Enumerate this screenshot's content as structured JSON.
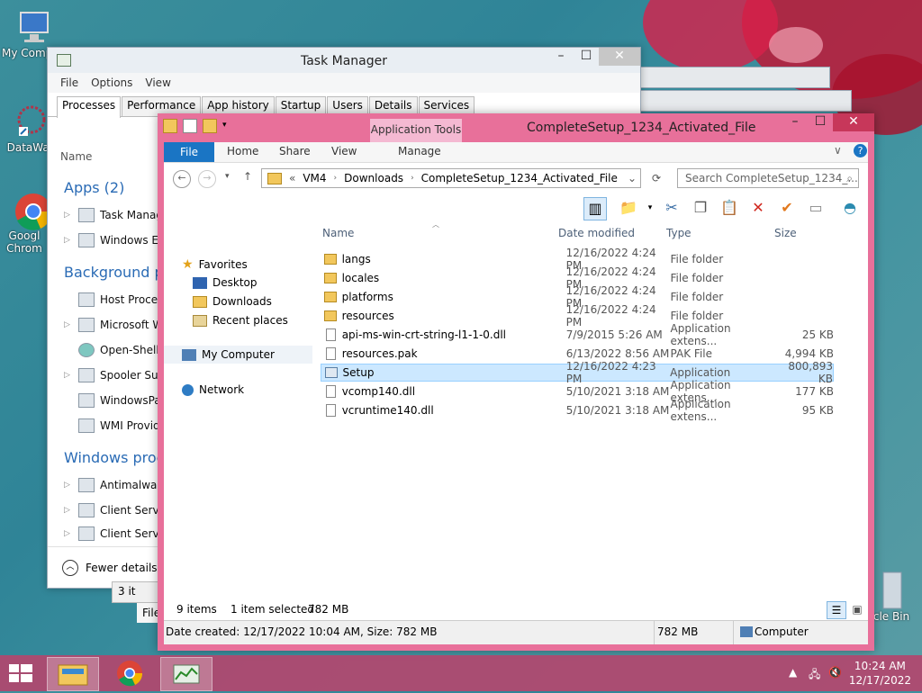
{
  "desktop": {
    "icons": [
      {
        "label": "My Comp"
      },
      {
        "label": "DataWag"
      },
      {
        "label": "Googl Chrom"
      },
      {
        "label": "cle Bin"
      }
    ]
  },
  "task_manager": {
    "title": "Task Manager",
    "menu": [
      "File",
      "Options",
      "View"
    ],
    "tabs": [
      "Processes",
      "Performance",
      "App history",
      "Startup",
      "Users",
      "Details",
      "Services"
    ],
    "column_name": "Name",
    "sections": {
      "apps": "Apps (2)",
      "background": "Background pr",
      "windows": "Windows proce"
    },
    "apps": [
      "Task Manag",
      "Windows Ex"
    ],
    "background": [
      "Host Proces",
      "Microsoft W",
      "Open-Shell",
      "Spooler Sub",
      "WindowsPa",
      "WMI Provid"
    ],
    "windows": [
      "Antimalwar",
      "Client Serve",
      "Client Serve"
    ],
    "fewer_details": "Fewer details",
    "partial_status": "3 it",
    "partial_file": "File"
  },
  "explorer": {
    "title": "CompleteSetup_1234_Activated_File",
    "app_tools": "Application Tools",
    "ribbon_tabs": {
      "file": "File",
      "home": "Home",
      "share": "Share",
      "view": "View",
      "manage": "Manage"
    },
    "address": {
      "prefix": "«",
      "crumbs": [
        "VM4",
        "Downloads",
        "CompleteSetup_1234_Activated_File"
      ]
    },
    "search_placeholder": "Search CompleteSetup_1234_...",
    "nav": {
      "favorites": "Favorites",
      "desktop": "Desktop",
      "downloads": "Downloads",
      "recent": "Recent places",
      "computer": "My Computer",
      "network": "Network"
    },
    "columns": {
      "name": "Name",
      "date": "Date modified",
      "type": "Type",
      "size": "Size"
    },
    "files": [
      {
        "name": "langs",
        "date": "12/16/2022 4:24 PM",
        "type": "File folder",
        "size": ""
      },
      {
        "name": "locales",
        "date": "12/16/2022 4:24 PM",
        "type": "File folder",
        "size": ""
      },
      {
        "name": "platforms",
        "date": "12/16/2022 4:24 PM",
        "type": "File folder",
        "size": ""
      },
      {
        "name": "resources",
        "date": "12/16/2022 4:24 PM",
        "type": "File folder",
        "size": ""
      },
      {
        "name": "api-ms-win-crt-string-l1-1-0.dll",
        "date": "7/9/2015 5:26 AM",
        "type": "Application extens...",
        "size": "25 KB"
      },
      {
        "name": "resources.pak",
        "date": "6/13/2022 8:56 AM",
        "type": "PAK File",
        "size": "4,994 KB"
      },
      {
        "name": "Setup",
        "date": "12/16/2022 4:23 PM",
        "type": "Application",
        "size": "800,893 KB"
      },
      {
        "name": "vcomp140.dll",
        "date": "5/10/2021 3:18 AM",
        "type": "Application extens...",
        "size": "177 KB"
      },
      {
        "name": "vcruntime140.dll",
        "date": "5/10/2021 3:18 AM",
        "type": "Application extens...",
        "size": "95 KB"
      }
    ],
    "status": {
      "items": "9 items",
      "selected": "1 item selected",
      "selected_size": "782 MB",
      "details": "Date created: 12/17/2022 10:04 AM, Size: 782 MB",
      "size": "782 MB",
      "location": "Computer"
    }
  },
  "taskbar": {
    "time": "10:24 AM",
    "date": "12/17/2022"
  },
  "colors": {
    "explorer_frame": "#e8709a",
    "file_tab": "#1a75c4",
    "selection": "#cce8ff",
    "taskbar": "#b2466e"
  }
}
